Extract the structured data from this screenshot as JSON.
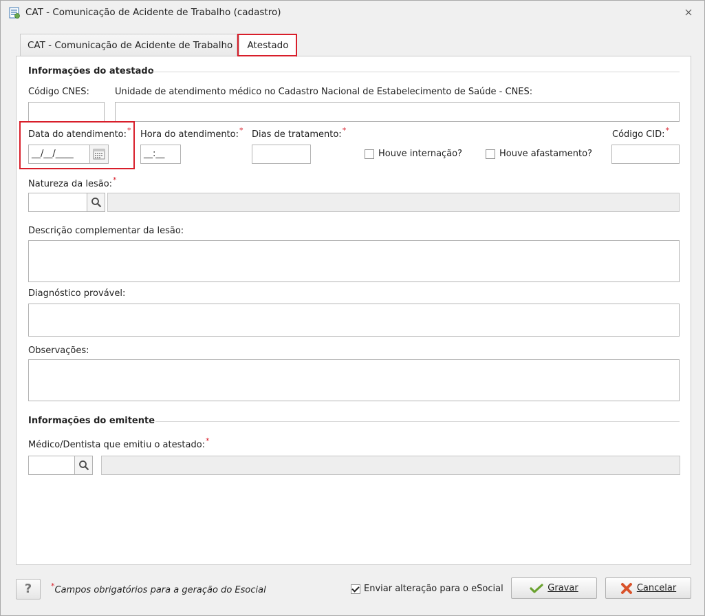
{
  "window": {
    "title": "CAT - Comunicação de Acidente de Trabalho (cadastro)"
  },
  "tabs": [
    {
      "label": "CAT - Comunicação de Acidente de Trabalho",
      "active": false
    },
    {
      "label": "Atestado",
      "active": true
    }
  ],
  "atestado": {
    "section_title": "Informações do atestado",
    "codigo_cnes_label": "Código CNES:",
    "unidade_label": "Unidade de atendimento médico no Cadastro Nacional de Estabelecimento de Saúde - CNES:",
    "data_label": "Data do atendimento:",
    "data_value": "__/__/____",
    "hora_label": "Hora do atendimento:",
    "hora_value": "__:__",
    "dias_label": "Dias de tratamento:",
    "internacao_label": "Houve internação?",
    "afastamento_label": "Houve afastamento?",
    "cid_label": "Código CID:",
    "natureza_label": "Natureza da lesão:",
    "descricao_label": "Descrição complementar da lesão:",
    "diagnostico_label": "Diagnóstico provável:",
    "observacoes_label": "Observações:",
    "required_mark": "*"
  },
  "emitente": {
    "section_title": "Informações do emitente",
    "medico_label": "Médico/Dentista que emitiu o atestado:"
  },
  "footer": {
    "help_label": "?",
    "required_note": "Campos obrigatórios para a geração do Esocial",
    "esocial_label": "Enviar alteração para o eSocial",
    "esocial_checked": true,
    "gravar_label": "Gravar",
    "cancelar_label": "Cancelar"
  },
  "colors": {
    "highlight": "#d81e2a",
    "required": "#d81e2a"
  }
}
